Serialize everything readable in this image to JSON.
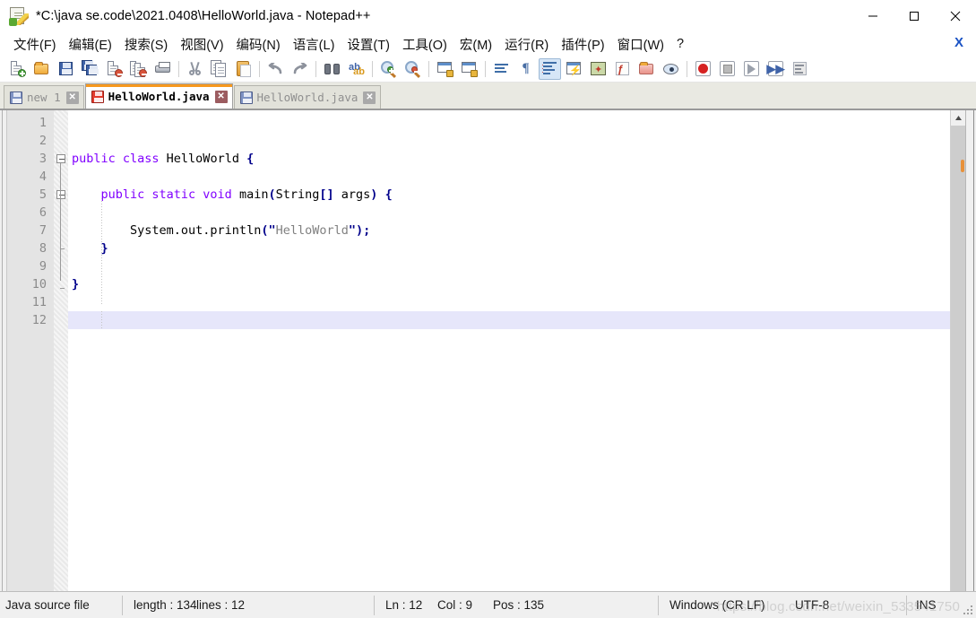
{
  "window": {
    "title": "*C:\\java se.code\\2021.0408\\HelloWorld.java - Notepad++",
    "app_icon": "notepad-plus-plus-icon",
    "minimize_label": "—",
    "maximize_label": "□",
    "close_label": "✕"
  },
  "menubar": {
    "items": [
      {
        "label": "文件(F)",
        "name": "menu-file"
      },
      {
        "label": "编辑(E)",
        "name": "menu-edit"
      },
      {
        "label": "搜索(S)",
        "name": "menu-search"
      },
      {
        "label": "视图(V)",
        "name": "menu-view"
      },
      {
        "label": "编码(N)",
        "name": "menu-encoding"
      },
      {
        "label": "语言(L)",
        "name": "menu-language"
      },
      {
        "label": "设置(T)",
        "name": "menu-settings"
      },
      {
        "label": "工具(O)",
        "name": "menu-tools"
      },
      {
        "label": "宏(M)",
        "name": "menu-macro"
      },
      {
        "label": "运行(R)",
        "name": "menu-run"
      },
      {
        "label": "插件(P)",
        "name": "menu-plugins"
      },
      {
        "label": "窗口(W)",
        "name": "menu-window"
      },
      {
        "label": "?",
        "name": "menu-help"
      }
    ],
    "close_document_label": "X"
  },
  "toolbar": {
    "buttons": [
      {
        "name": "new-file-icon",
        "kind": "doc-new"
      },
      {
        "name": "open-file-icon",
        "kind": "folder-open"
      },
      {
        "name": "save-icon",
        "kind": "floppy"
      },
      {
        "name": "save-all-icon",
        "kind": "floppy-multi"
      },
      {
        "name": "close-file-icon",
        "kind": "doc-close"
      },
      {
        "name": "close-all-icon",
        "kind": "doc-close-multi"
      },
      {
        "name": "print-icon",
        "kind": "printer"
      },
      {
        "name": "separator",
        "kind": "sep"
      },
      {
        "name": "cut-icon",
        "kind": "scissors"
      },
      {
        "name": "copy-icon",
        "kind": "copy"
      },
      {
        "name": "paste-icon",
        "kind": "clipboard"
      },
      {
        "name": "separator",
        "kind": "sep"
      },
      {
        "name": "undo-icon",
        "kind": "undo"
      },
      {
        "name": "redo-icon",
        "kind": "redo"
      },
      {
        "name": "separator",
        "kind": "sep"
      },
      {
        "name": "find-icon",
        "kind": "binoculars"
      },
      {
        "name": "replace-icon",
        "kind": "replace"
      },
      {
        "name": "separator",
        "kind": "sep"
      },
      {
        "name": "zoom-in-icon",
        "kind": "zoom-in"
      },
      {
        "name": "zoom-out-icon",
        "kind": "zoom-out"
      },
      {
        "name": "separator",
        "kind": "sep"
      },
      {
        "name": "sync-vertical-icon",
        "kind": "sync-v"
      },
      {
        "name": "sync-horizontal-icon",
        "kind": "sync-h"
      },
      {
        "name": "separator",
        "kind": "sep"
      },
      {
        "name": "word-wrap-icon",
        "kind": "wrap"
      },
      {
        "name": "show-all-chars-icon",
        "kind": "pilcrow"
      },
      {
        "name": "indent-guide-icon",
        "kind": "guides",
        "active": true
      },
      {
        "name": "ui-userdefined-icon",
        "kind": "udl"
      },
      {
        "name": "document-map-icon",
        "kind": "map"
      },
      {
        "name": "function-list-icon",
        "kind": "funclist"
      },
      {
        "name": "folder-workspace-icon",
        "kind": "workspace"
      },
      {
        "name": "monitoring-icon",
        "kind": "eye"
      },
      {
        "name": "separator",
        "kind": "sep"
      },
      {
        "name": "macro-record-icon",
        "kind": "record"
      },
      {
        "name": "macro-stop-icon",
        "kind": "stop"
      },
      {
        "name": "macro-play-icon",
        "kind": "play"
      },
      {
        "name": "macro-playmany-icon",
        "kind": "playmany"
      },
      {
        "name": "macro-save-icon",
        "kind": "macrosave"
      }
    ]
  },
  "tabs": [
    {
      "label": "new 1",
      "active": false,
      "modified": false,
      "close_label": "✕"
    },
    {
      "label": "HelloWorld.java",
      "active": true,
      "modified": true,
      "close_label": "✕"
    },
    {
      "label": "HelloWorld.java",
      "active": false,
      "modified": false,
      "close_label": "✕"
    }
  ],
  "editor": {
    "line_numbers": [
      "1",
      "2",
      "3",
      "4",
      "5",
      "6",
      "7",
      "8",
      "9",
      "10",
      "11",
      "12"
    ],
    "current_line": 12,
    "lines": [
      {
        "n": 1,
        "tokens": []
      },
      {
        "n": 2,
        "tokens": []
      },
      {
        "n": 3,
        "tokens": [
          {
            "t": "public class ",
            "c": "kw"
          },
          {
            "t": "HelloWorld ",
            "c": "id"
          },
          {
            "t": "{",
            "c": "pn"
          }
        ]
      },
      {
        "n": 4,
        "tokens": []
      },
      {
        "n": 5,
        "tokens": [
          {
            "t": "    ",
            "c": "id"
          },
          {
            "t": "public static void ",
            "c": "kw"
          },
          {
            "t": "main",
            "c": "id"
          },
          {
            "t": "(",
            "c": "pn"
          },
          {
            "t": "String",
            "c": "id"
          },
          {
            "t": "[]",
            "c": "pn"
          },
          {
            "t": " args",
            "c": "id"
          },
          {
            "t": ")",
            "c": "pn"
          },
          {
            "t": " ",
            "c": "id"
          },
          {
            "t": "{",
            "c": "pn"
          }
        ]
      },
      {
        "n": 6,
        "tokens": []
      },
      {
        "n": 7,
        "tokens": [
          {
            "t": "        System.out.println",
            "c": "id"
          },
          {
            "t": "(\"",
            "c": "pn"
          },
          {
            "t": "HelloWorld",
            "c": "str"
          },
          {
            "t": "\");",
            "c": "pn"
          }
        ]
      },
      {
        "n": 8,
        "tokens": [
          {
            "t": "    ",
            "c": "id"
          },
          {
            "t": "}",
            "c": "pn"
          }
        ]
      },
      {
        "n": 9,
        "tokens": []
      },
      {
        "n": 10,
        "tokens": [
          {
            "t": "}",
            "c": "pn"
          }
        ]
      },
      {
        "n": 11,
        "tokens": []
      },
      {
        "n": 12,
        "tokens": []
      }
    ],
    "fold_points": [
      3,
      5
    ]
  },
  "statusbar": {
    "file_type": "Java source file",
    "length_label": "length : 134",
    "lines_label": "lines : 12",
    "ln_label": "Ln : 12",
    "col_label": "Col : 9",
    "pos_label": "Pos : 135",
    "eol_label": "Windows (CR LF)",
    "encoding_label": "UTF-8",
    "insert_mode_label": "INS"
  },
  "watermark": "https://blog.csdn.net/weixin_533541750",
  "colors": {
    "keyword": "#8000ff",
    "punctuation": "#00008b",
    "string": "#808080",
    "identifier": "#000000",
    "active_tab_accent": "#f7981d",
    "current_line_highlight": "#e6e6fa",
    "gutter_bg": "#e4e4e4"
  }
}
